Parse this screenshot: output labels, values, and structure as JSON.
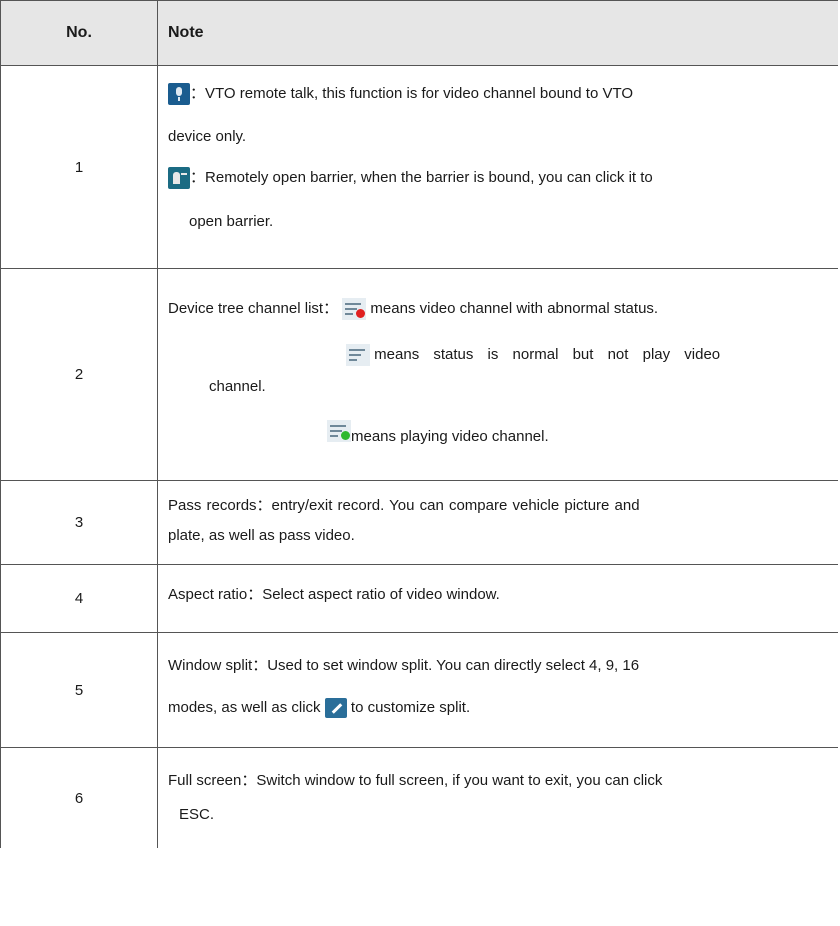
{
  "header": {
    "no": "No.",
    "note": "Note"
  },
  "rows": [
    {
      "no": "1",
      "l1_sep": "：",
      "l1": "VTO remote talk, this function is for video channel bound to VTO",
      "l2": "device only.",
      "l3_sep": "：",
      "l3": "Remotely open barrier, when the barrier is bound, you can click it to",
      "l4": "open barrier."
    },
    {
      "no": "2",
      "l1_pre": "Device tree channel list：",
      "l1_post": "means video channel with abnormal status.",
      "l2_post": "means status is normal but not play video",
      "l3": "channel.",
      "l4_post": "means playing video channel."
    },
    {
      "no": "3",
      "l1": "Pass records：entry/exit record. You can compare vehicle picture and",
      "l2": "plate, as well as pass video."
    },
    {
      "no": "4",
      "l1": "Aspect ratio：Select aspect ratio of video window."
    },
    {
      "no": "5",
      "l1": "Window split：Used to set window split. You can directly select 4, 9, 16",
      "l2_pre": "modes, as well as click",
      "l2_post": "to customize split."
    },
    {
      "no": "6",
      "l1": "Full screen：Switch window to full screen, if you want to exit, you can click",
      "l2": "ESC."
    }
  ],
  "icons": {
    "talk": "microphone-icon",
    "barrier": "barrier-gate-icon",
    "abnormal": "channel-abnormal-icon",
    "normal": "channel-normal-icon",
    "playing": "channel-playing-icon",
    "custom_split": "edit-icon"
  }
}
